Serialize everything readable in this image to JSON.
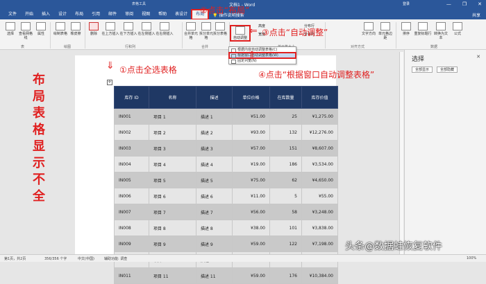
{
  "window": {
    "context_tab": "表格工具",
    "doc_title": "文档1 - Word",
    "account": "登录",
    "minimize": "—",
    "restore": "❐",
    "close": "✕"
  },
  "tabs": [
    "文件",
    "开始",
    "插入",
    "设计",
    "布局",
    "引用",
    "邮件",
    "审阅",
    "视图",
    "帮助",
    "表设计",
    "布局"
  ],
  "active_tab_index": 11,
  "tell_me": "操作说明搜索",
  "share": "共享",
  "ribbon": {
    "buttons": [
      "选择",
      "查看网格线",
      "属性",
      "绘制表格",
      "橡皮擦",
      "删除",
      "在上方插入",
      "在下方插入",
      "在左侧插入",
      "在右侧插入",
      "合并单元格",
      "拆分单元格",
      "拆分表格",
      "自动调整",
      "高度",
      "宽度",
      "分布行",
      "分布列",
      "文字方向",
      "单元格边距",
      "排序",
      "重复标题行",
      "转换为文本",
      "公式"
    ],
    "groups": [
      "表",
      "绘图",
      "行和列",
      "合并",
      "单元格大小",
      "对齐方式",
      "数据"
    ]
  },
  "autofit_menu": [
    "根据内容自动调整表格(C)",
    "根据窗口自动调整表格(W)",
    "固定列宽(N)"
  ],
  "annotations": {
    "step1": "①点击全选表格",
    "step2": "②点击“布局”",
    "step3": "③点击“自动调整”",
    "step4": "④点击“根据窗口自动调整表格”",
    "side_note": "布局表格显示不全"
  },
  "table": {
    "headers": [
      "库存 ID",
      "名称",
      "描述",
      "单位价格",
      "在库数量",
      "库存价值"
    ],
    "rows": [
      [
        "IN001",
        "项目 1",
        "描述 1",
        "¥51.00",
        "25",
        "¥1,275.00"
      ],
      [
        "IN002",
        "项目 2",
        "描述 2",
        "¥93.00",
        "132",
        "¥12,276.00"
      ],
      [
        "IN003",
        "项目 3",
        "描述 3",
        "¥57.00",
        "151",
        "¥8,607.00"
      ],
      [
        "IN004",
        "项目 4",
        "描述 4",
        "¥19.00",
        "186",
        "¥3,534.00"
      ],
      [
        "IN005",
        "项目 5",
        "描述 5",
        "¥75.00",
        "62",
        "¥4,650.00"
      ],
      [
        "IN006",
        "项目 6",
        "描述 6",
        "¥11.00",
        "5",
        "¥55.00"
      ],
      [
        "IN007",
        "项目 7",
        "描述 7",
        "¥56.00",
        "58",
        "¥3,248.00"
      ],
      [
        "IN008",
        "项目 8",
        "描述 8",
        "¥38.00",
        "101",
        "¥3,838.00"
      ],
      [
        "IN009",
        "项目 9",
        "描述 9",
        "¥59.00",
        "122",
        "¥7,198.00"
      ],
      [
        "IN010",
        "项目 10",
        "描述 10",
        "¥50.00",
        "175",
        "¥8,750.00"
      ],
      [
        "IN011",
        "项目 11",
        "描述 11",
        "¥59.00",
        "176",
        "¥10,384.00"
      ]
    ]
  },
  "pane": {
    "title": "选择",
    "show_all": "全部显示",
    "hide_all": "全部隐藏"
  },
  "status": {
    "page": "第1页，共2页",
    "words": "356/356 个字",
    "lang": "中文(中国)",
    "accessibility": "辅助功能: 调查",
    "zoom": "100%"
  },
  "watermark": "头条@数据蛙恢复软件",
  "colors": {
    "accent": "#2b579a",
    "annotation_red": "#e02020",
    "table_header": "#1f3864"
  }
}
